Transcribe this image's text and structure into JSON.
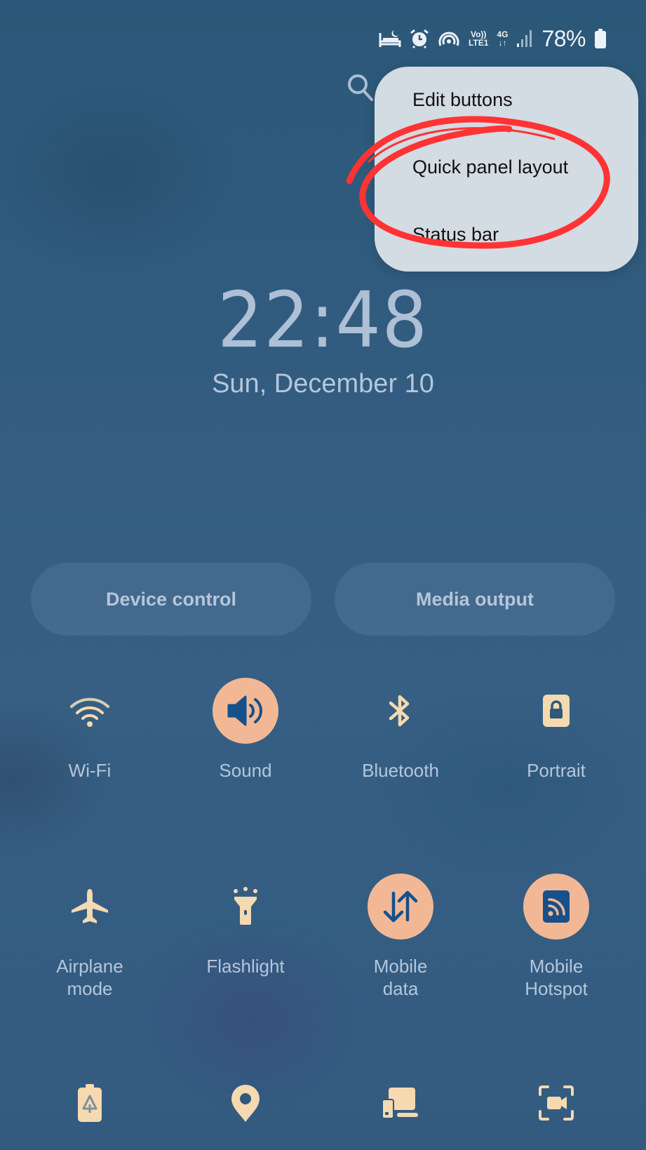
{
  "status_bar": {
    "icons": [
      "sleep-mode-icon",
      "alarm-icon",
      "hotspot-active-icon",
      "volte-lte1-icon",
      "4g-data-icon",
      "signal-strength-icon",
      "battery-icon"
    ],
    "volte_top": "Vo))",
    "volte_bottom": "LTE1",
    "network_type": "4G",
    "battery_percent": "78%"
  },
  "search": {
    "icon": "search-icon"
  },
  "menu": {
    "items": [
      {
        "label": "Edit buttons"
      },
      {
        "label": "Quick panel layout",
        "highlighted": true
      },
      {
        "label": "Status bar"
      }
    ],
    "annotation_color": "#ff3333"
  },
  "clock": {
    "time": "22:48",
    "date": "Sun, December 10"
  },
  "shortcuts": {
    "device_control": "Device control",
    "media_output": "Media output"
  },
  "tiles": [
    {
      "label": "Wi-Fi",
      "icon": "wifi-icon",
      "active": false
    },
    {
      "label": "Sound",
      "icon": "sound-icon",
      "active": true
    },
    {
      "label": "Bluetooth",
      "icon": "bluetooth-icon",
      "active": false
    },
    {
      "label": "Portrait",
      "icon": "portrait-lock-icon",
      "active": false
    },
    {
      "label": "Airplane mode",
      "label_lines": [
        "Airplane",
        "mode"
      ],
      "icon": "airplane-icon",
      "active": false
    },
    {
      "label": "Flashlight",
      "icon": "flashlight-icon",
      "active": false
    },
    {
      "label": "Mobile data",
      "label_lines": [
        "Mobile",
        "data"
      ],
      "icon": "mobile-data-icon",
      "active": true
    },
    {
      "label": "Mobile Hotspot",
      "label_lines": [
        "Mobile",
        "Hotspot"
      ],
      "icon": "hotspot-icon",
      "active": true
    },
    {
      "icon": "power-saving-icon",
      "active": false
    },
    {
      "icon": "location-icon",
      "active": false
    },
    {
      "icon": "device-link-icon",
      "active": false
    },
    {
      "icon": "screen-recorder-icon",
      "active": false
    }
  ],
  "colors": {
    "tile_active_bg": "#f2b896",
    "tile_icon": "#f5d9b0",
    "active_icon": "#17508a",
    "text_muted": "#b5c6db",
    "menu_bg": "#d3dbe3"
  }
}
